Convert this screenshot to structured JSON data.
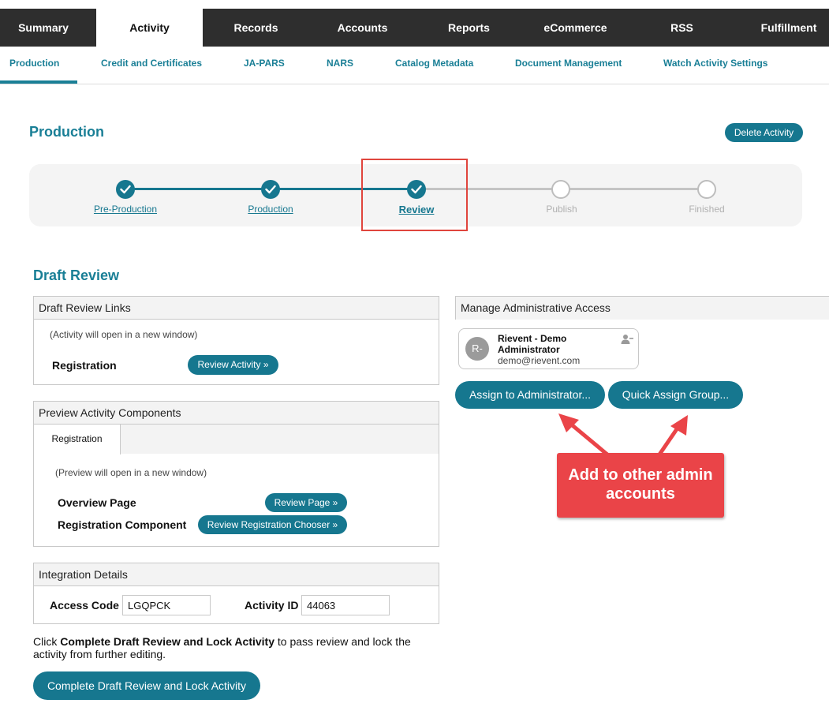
{
  "top_nav": {
    "tabs": [
      "Summary",
      "Activity",
      "Records",
      "Accounts",
      "Reports",
      "eCommerce",
      "RSS",
      "Fulfillment"
    ],
    "active": "Activity"
  },
  "sub_nav": {
    "items": [
      "Production",
      "Credit and Certificates",
      "JA-PARS",
      "NARS",
      "Catalog Metadata",
      "Document Management",
      "Watch Activity Settings"
    ],
    "active": "Production"
  },
  "page": {
    "title": "Production",
    "delete_button": "Delete Activity"
  },
  "stepper": {
    "steps": [
      {
        "label": "Pre-Production",
        "state": "done"
      },
      {
        "label": "Production",
        "state": "done"
      },
      {
        "label": "Review",
        "state": "current"
      },
      {
        "label": "Publish",
        "state": "todo"
      },
      {
        "label": "Finished",
        "state": "todo"
      }
    ]
  },
  "draft_review": {
    "title": "Draft Review",
    "links_panel": {
      "header": "Draft Review Links",
      "note": "(Activity will open in a new window)",
      "row_label": "Registration",
      "button": "Review Activity »"
    },
    "preview_panel": {
      "header": "Preview Activity Components",
      "tab": "Registration",
      "note": "(Preview will open in a new window)",
      "rows": [
        {
          "label": "Overview Page",
          "button": "Review Page »"
        },
        {
          "label": "Registration Component",
          "button": "Review Registration Chooser »"
        }
      ]
    },
    "integration_panel": {
      "header": "Integration Details",
      "access_code_label": "Access Code",
      "access_code_value": "LGQPCK",
      "activity_id_label": "Activity ID",
      "activity_id_value": "44063"
    },
    "instructions": {
      "pre": "Click ",
      "bold": "Complete Draft Review and Lock Activity",
      "post": " to pass review and lock the activity from further editing."
    },
    "complete_button": "Complete Draft Review and Lock Activity"
  },
  "admin_access": {
    "header": "Manage Administrative Access",
    "admin": {
      "initials": "R-",
      "name": "Rievent - Demo Administrator",
      "email": "demo@rievent.com"
    },
    "assign_button": "Assign to Administrator...",
    "quick_assign_button": "Quick Assign Group..."
  },
  "callout": {
    "line1": "Add to other admin",
    "line2": "accounts"
  },
  "colors": {
    "accent": "#16778f",
    "link": "#1a7f96",
    "nav_bg": "#2e2e2e",
    "highlight": "#e0453d",
    "callout": "#ea4448"
  }
}
